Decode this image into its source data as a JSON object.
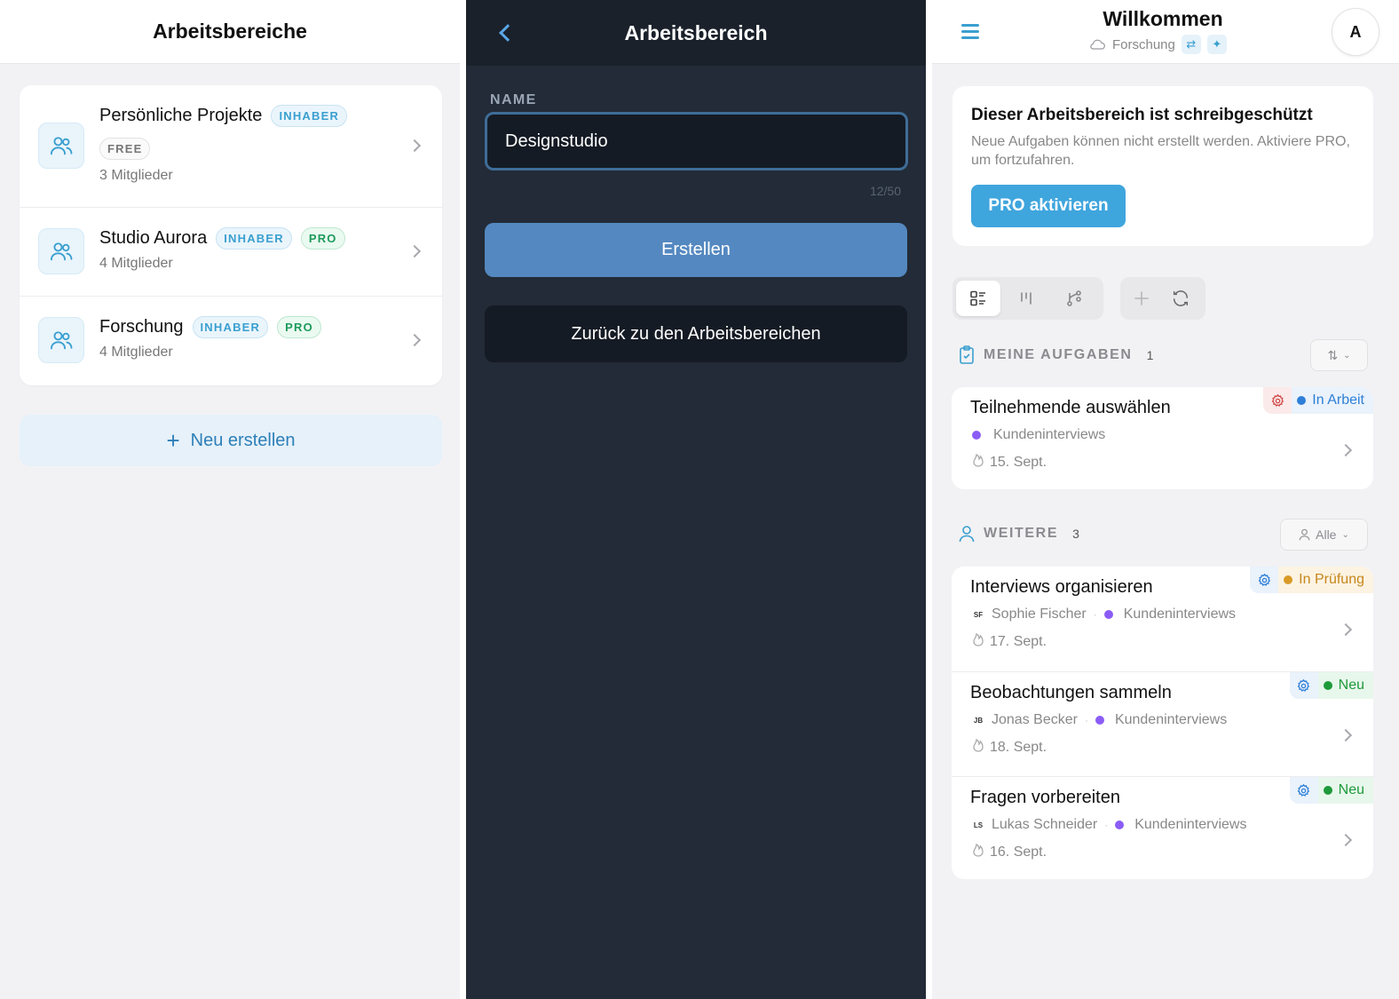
{
  "panel1": {
    "title": "Arbeitsbereiche",
    "workspaces": [
      {
        "name": "Persönliche Projekte",
        "owner_badge": "INHABER",
        "plan_badge": "FREE",
        "members": "3 Mitglieder"
      },
      {
        "name": "Studio Aurora",
        "owner_badge": "INHABER",
        "plan_badge": "PRO",
        "members": "4 Mitglieder"
      },
      {
        "name": "Forschung",
        "owner_badge": "INHABER",
        "plan_badge": "PRO",
        "members": "4 Mitglieder"
      }
    ],
    "new_button": "Neu erstellen"
  },
  "panel2": {
    "title": "Arbeitsbereich",
    "name_label": "NAME",
    "name_value": "Designstudio",
    "counter": "12/50",
    "create_button": "Erstellen",
    "back_button": "Zurück zu den Arbeitsbereichen"
  },
  "panel3": {
    "title": "Willkommen",
    "workspace": "Forschung",
    "avatar": "A",
    "readonly": {
      "title": "Dieser Arbeitsbereich ist schreibgeschützt",
      "description": "Neue Aufgaben können nicht erstellt werden. Aktiviere PRO, um fortzufahren.",
      "button": "PRO aktivieren"
    },
    "my_tasks": {
      "label": "MEINE AUFGABEN",
      "count": "1",
      "items": [
        {
          "title": "Teilnehmende auswählen",
          "project": "Kundeninterviews",
          "date": "15. Sept.",
          "status": "In Arbeit"
        }
      ]
    },
    "others": {
      "label": "WEITERE",
      "count": "3",
      "filter": "Alle",
      "items": [
        {
          "title": "Interviews organisieren",
          "initials": "SF",
          "assignee": "Sophie Fischer",
          "project": "Kundeninterviews",
          "date": "17. Sept.",
          "status": "In Prüfung"
        },
        {
          "title": "Beobachtungen sammeln",
          "initials": "JB",
          "assignee": "Jonas Becker",
          "project": "Kundeninterviews",
          "date": "18. Sept.",
          "status": "Neu"
        },
        {
          "title": "Fragen vorbereiten",
          "initials": "LS",
          "assignee": "Lukas Schneider",
          "project": "Kundeninterviews",
          "date": "16. Sept.",
          "status": "Neu"
        }
      ]
    }
  },
  "colors": {
    "accent": "#3a9fd0",
    "status_in_progress": "#2d7fd8",
    "status_review": "#c7861a",
    "status_new": "#1e9a3a",
    "project_dot": "#8b5cf6"
  }
}
